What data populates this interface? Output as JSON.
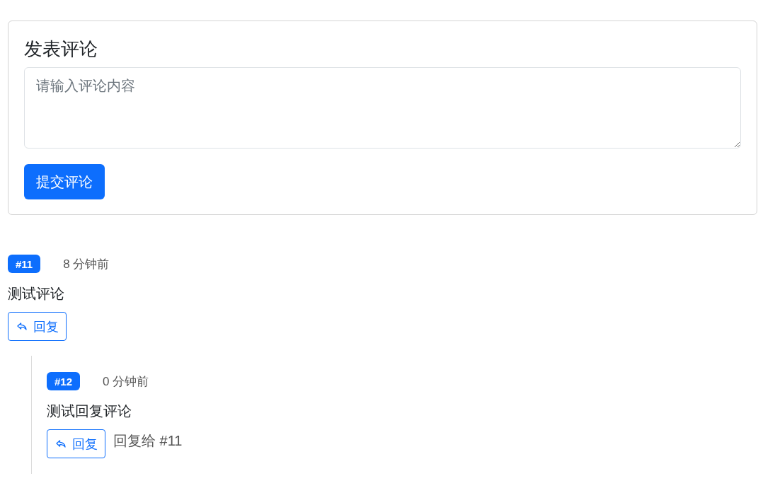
{
  "comment_form": {
    "title": "发表评论",
    "textarea": {
      "placeholder": "请输入评论内容"
    },
    "submit_button": "提交评论"
  },
  "comments": [
    {
      "number": "#11",
      "time": "8 分钟前",
      "content": "测试评论",
      "reply_button": "回复",
      "children": [
        {
          "number": "#12",
          "time": "0 分钟前",
          "content": "测试回复评论",
          "reply_button": "回复",
          "reply_to": "回复给 #11"
        }
      ]
    }
  ]
}
